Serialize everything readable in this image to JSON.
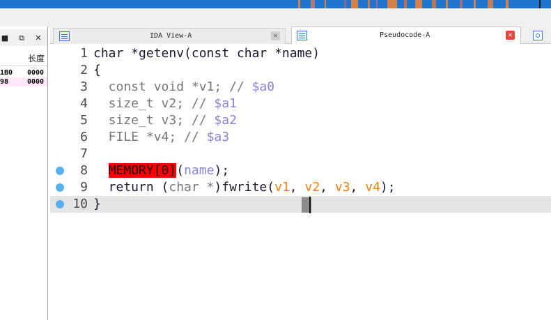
{
  "nav_band": {
    "base_color": "#1f74d0",
    "segments": [
      {
        "color": "#d4824a"
      },
      {
        "color": "#b07a7a"
      },
      {
        "color": "#d4824a"
      },
      {
        "color": "#8a6a90"
      },
      {
        "color": "#d4824a"
      },
      {
        "color": "#c87a50"
      },
      {
        "color": "#9a7090"
      },
      {
        "color": "#d4824a"
      },
      {
        "color": "#c07050"
      },
      {
        "color": "#d4824a"
      },
      {
        "color": "#b87858"
      },
      {
        "color": "#d4824a"
      },
      {
        "color": "#a07080"
      },
      {
        "color": "#d4824a"
      },
      {
        "color": "#c08060"
      },
      {
        "color": "#d4824a"
      }
    ]
  },
  "left_pane": {
    "restore_icon": "restore-window-icon",
    "close_icon": "close-icon",
    "header_len": "长度",
    "rows": [
      {
        "addr": "1B0",
        "len": "0000",
        "bg": "#ffffff"
      },
      {
        "addr": "98",
        "len": "0000",
        "bg": "#fde8f8"
      }
    ]
  },
  "tabs": {
    "ida_view": {
      "label": "IDA View-A",
      "icon": "disassembly-view-icon",
      "close": "✕"
    },
    "pseudocode": {
      "label": "Pseudocode-A",
      "icon": "pseudocode-view-icon",
      "close": "✕"
    },
    "extra": {
      "icon": "hex-view-icon"
    }
  },
  "editor": {
    "lines": [
      {
        "num": "1",
        "bp": false,
        "tokens": [
          {
            "t": "char *getenv(const char *name)",
            "c": "black"
          }
        ]
      },
      {
        "num": "2",
        "bp": false,
        "tokens": [
          {
            "t": "{",
            "c": "black"
          }
        ]
      },
      {
        "num": "3",
        "bp": false,
        "tokens": [
          {
            "t": "  const void *v1; // ",
            "c": "gray"
          },
          {
            "t": "$a0",
            "c": "purple"
          }
        ]
      },
      {
        "num": "4",
        "bp": false,
        "tokens": [
          {
            "t": "  size_t v2; // ",
            "c": "gray"
          },
          {
            "t": "$a1",
            "c": "purple"
          }
        ]
      },
      {
        "num": "5",
        "bp": false,
        "tokens": [
          {
            "t": "  size_t v3; // ",
            "c": "gray"
          },
          {
            "t": "$a2",
            "c": "purple"
          }
        ]
      },
      {
        "num": "6",
        "bp": false,
        "tokens": [
          {
            "t": "  FILE *v4; // ",
            "c": "gray"
          },
          {
            "t": "$a3",
            "c": "purple"
          }
        ]
      },
      {
        "num": "7",
        "bp": false,
        "tokens": []
      },
      {
        "num": "8",
        "bp": true,
        "tokens": [
          {
            "t": "  ",
            "c": "black"
          },
          {
            "t": "MEMORY[0]",
            "c": "red"
          },
          {
            "t": "(",
            "c": "black"
          },
          {
            "t": "name",
            "c": "purple"
          },
          {
            "t": ");",
            "c": "black"
          }
        ]
      },
      {
        "num": "9",
        "bp": true,
        "tokens": [
          {
            "t": "  return (",
            "c": "black"
          },
          {
            "t": "char *",
            "c": "gray"
          },
          {
            "t": ")fwrite(",
            "c": "black"
          },
          {
            "t": "v1",
            "c": "orange"
          },
          {
            "t": ", ",
            "c": "black"
          },
          {
            "t": "v2",
            "c": "orange"
          },
          {
            "t": ", ",
            "c": "black"
          },
          {
            "t": "v3",
            "c": "orange"
          },
          {
            "t": ", ",
            "c": "black"
          },
          {
            "t": "v4",
            "c": "orange"
          },
          {
            "t": ");",
            "c": "black"
          }
        ]
      },
      {
        "num": "10",
        "bp": true,
        "current": true,
        "tokens": [
          {
            "t": "}",
            "c": "black"
          }
        ]
      }
    ]
  }
}
